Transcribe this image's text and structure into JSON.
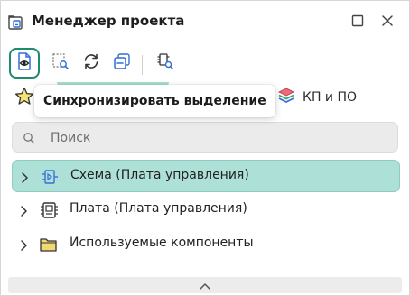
{
  "window": {
    "title": "Менеджер проекта",
    "title_icon": "project-manager-icon",
    "maximize_icon": "maximize-icon",
    "close_icon": "close-icon"
  },
  "toolbar": {
    "tools": [
      {
        "icon": "document-eye-icon",
        "active": true
      },
      {
        "icon": "document-search-icon",
        "active": false
      },
      {
        "icon": "refresh-icon",
        "active": false
      },
      {
        "icon": "collapse-all-icon",
        "active": false
      },
      {
        "icon": "component-search-icon",
        "active": false
      }
    ]
  },
  "tabs": {
    "favorites_icon": "star-icon",
    "kp_label": "КП и ПО",
    "kp_icon": "layers-icon"
  },
  "tooltip": {
    "text": "Синхронизировать выделение"
  },
  "search": {
    "placeholder": "Поиск",
    "value": ""
  },
  "tree": {
    "items": [
      {
        "label": "Схема (Плата управления)",
        "icon": "schematic-icon",
        "selected": true
      },
      {
        "label": "Плата (Плата управления)",
        "icon": "board-icon",
        "selected": false
      },
      {
        "label": "Используемые компоненты",
        "icon": "folder-icon",
        "selected": false
      }
    ]
  },
  "colors": {
    "accent": "#1e8a6e",
    "selection": "#ade0d6",
    "icon_blue": "#3a6fd8",
    "folder": "#f2d873"
  }
}
